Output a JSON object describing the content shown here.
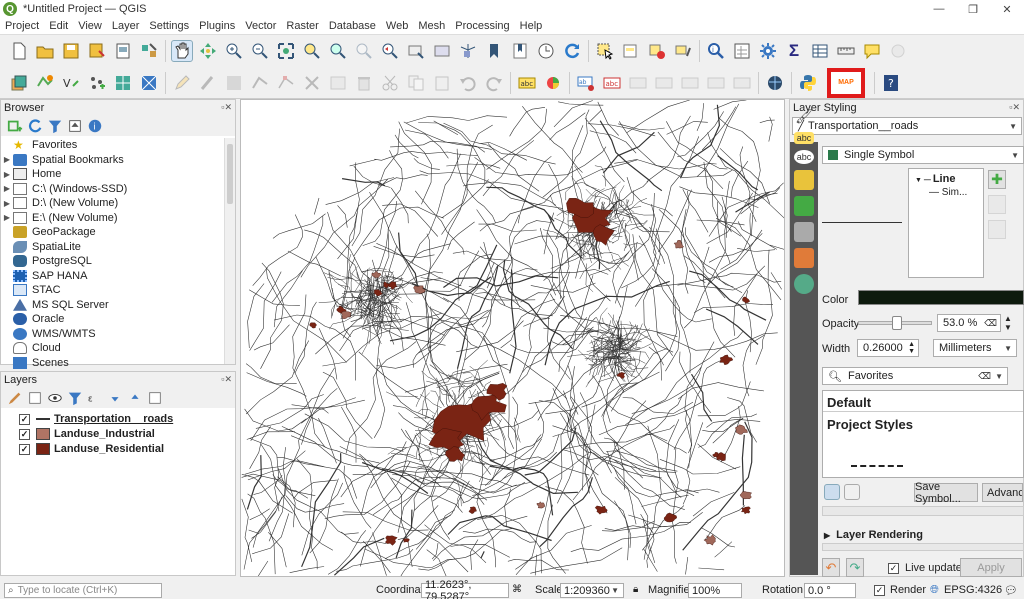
{
  "window": {
    "title": "*Untitled Project — QGIS",
    "app_initial": "Q",
    "minimize": "—",
    "restore": "❐",
    "close": "✕"
  },
  "menu": [
    "Project",
    "Edit",
    "View",
    "Layer",
    "Settings",
    "Plugins",
    "Vector",
    "Raster",
    "Database",
    "Web",
    "Mesh",
    "Processing",
    "Help"
  ],
  "highlight": {
    "plugin_label": "MAP",
    "color": "#e01b1b"
  },
  "browser": {
    "title": "Browser",
    "items": [
      {
        "label": "Favorites",
        "arrow": "",
        "icon": "star-icon"
      },
      {
        "label": "Spatial Bookmarks",
        "arrow": "▶",
        "icon": "bookmark-icon"
      },
      {
        "label": "Home",
        "arrow": "▶",
        "icon": "home-icon"
      },
      {
        "label": "C:\\ (Windows-SSD)",
        "arrow": "▶",
        "icon": "folder-icon"
      },
      {
        "label": "D:\\ (New Volume)",
        "arrow": "▶",
        "icon": "folder-icon"
      },
      {
        "label": "E:\\ (New Volume)",
        "arrow": "▶",
        "icon": "folder-icon"
      },
      {
        "label": "GeoPackage",
        "arrow": "",
        "icon": "geopackage-icon"
      },
      {
        "label": "SpatiaLite",
        "arrow": "",
        "icon": "spatialite-icon"
      },
      {
        "label": "PostgreSQL",
        "arrow": "",
        "icon": "postgresql-icon"
      },
      {
        "label": "SAP HANA",
        "arrow": "",
        "icon": "sap-hana-icon"
      },
      {
        "label": "STAC",
        "arrow": "",
        "icon": "stac-icon"
      },
      {
        "label": "MS SQL Server",
        "arrow": "",
        "icon": "mssql-icon"
      },
      {
        "label": "Oracle",
        "arrow": "",
        "icon": "oracle-icon"
      },
      {
        "label": "WMS/WMTS",
        "arrow": "",
        "icon": "wms-icon"
      },
      {
        "label": "Cloud",
        "arrow": "",
        "icon": "cloud-icon"
      },
      {
        "label": "Scenes",
        "arrow": "",
        "icon": "scenes-icon"
      }
    ]
  },
  "layers": {
    "title": "Layers",
    "items": [
      {
        "label": "Transportation__roads",
        "swatch": "",
        "checked": "✓"
      },
      {
        "label": "Landuse_Industrial",
        "swatch": "#b07464",
        "checked": "✓"
      },
      {
        "label": "Landuse_Residential",
        "swatch": "#7a2414",
        "checked": "✓"
      }
    ]
  },
  "styling": {
    "title": "Layer Styling",
    "layer": "Transportation__roads",
    "renderer": "Single Symbol",
    "tree_line": "Line",
    "tree_sub": "Sim...",
    "color_label": "Color",
    "color_value": "#0d1a0d",
    "opacity_label": "Opacity",
    "opacity_value": "53.0 %",
    "opacity_fraction": 0.53,
    "width_label": "Width",
    "width_value": "0.26000",
    "unit": "Millimeters",
    "search": "Favorites",
    "lib_default": "Default",
    "lib_project": "Project Styles",
    "save_symbol": "Save Symbol...",
    "advanced": "Advance",
    "layer_rendering": "Layer Rendering",
    "live_update": "Live update",
    "apply": "Apply"
  },
  "status": {
    "locate_placeholder": "Type to locate (Ctrl+K)",
    "coordinate_label": "Coordinate",
    "coordinate_value": "11.2623°, 79.5287°",
    "scale_label": "Scale",
    "scale_value": "1:209360",
    "magnifier_label": "Magnifier",
    "magnifier_value": "100%",
    "rotation_label": "Rotation",
    "rotation_value": "0.0 °",
    "render_label": "Render",
    "crs": "EPSG:4326"
  },
  "map_colors": {
    "roads": "#111111",
    "residential": "#7a2414",
    "industrial": "#a0685a"
  }
}
